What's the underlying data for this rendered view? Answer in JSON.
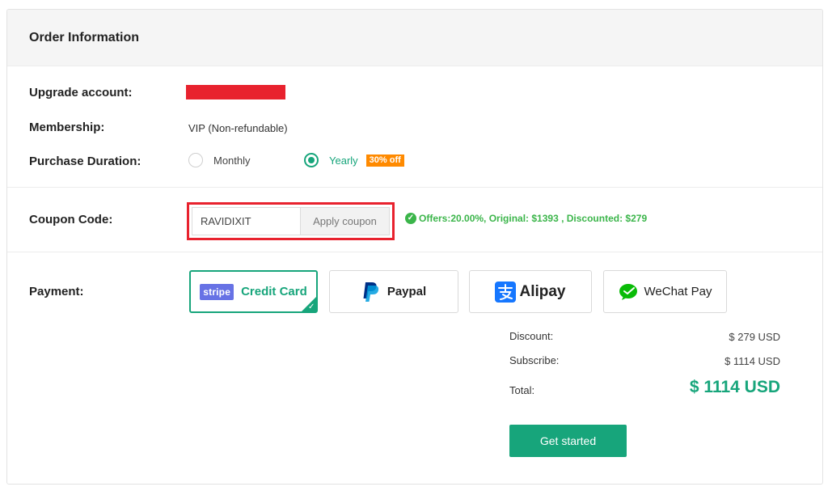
{
  "header": {
    "title": "Order Information"
  },
  "upgrade_account": {
    "label": "Upgrade account:",
    "redacted": true
  },
  "membership": {
    "label": "Membership:",
    "value": "VIP (Non-refundable)"
  },
  "duration": {
    "label": "Purchase Duration:",
    "options": [
      {
        "label": "Monthly",
        "selected": false
      },
      {
        "label": "Yearly",
        "selected": true,
        "badge": "30% off"
      }
    ]
  },
  "coupon": {
    "label": "Coupon Code:",
    "value": "RAVIDIXIT",
    "apply_label": "Apply coupon",
    "offer_text": "Offers:20.00%, Original: $1393 , Discounted: $279"
  },
  "payment": {
    "label": "Payment:",
    "methods": [
      {
        "name": "Credit Card",
        "logo_text": "stripe",
        "icon": "stripe-icon",
        "selected": true
      },
      {
        "name": "Paypal",
        "icon": "paypal-icon",
        "selected": false
      },
      {
        "name": "Alipay",
        "icon": "alipay-icon",
        "selected": false
      },
      {
        "name": "WeChat Pay",
        "icon": "wechat-icon",
        "selected": false
      }
    ]
  },
  "summary": {
    "discount_label": "Discount:",
    "discount_value": "$ 279 USD",
    "subscribe_label": "Subscribe:",
    "subscribe_value": "$ 1114 USD",
    "total_label": "Total:",
    "total_value": "$ 1114 USD"
  },
  "cta": {
    "label": "Get started"
  },
  "colors": {
    "accent": "#17a57b",
    "redaction": "#e8222e",
    "badge": "#ff8a00",
    "offer": "#3bb54a",
    "stripe": "#6772e5",
    "paypal": "#003087",
    "alipay": "#1677ff",
    "wechat": "#09bb07"
  }
}
